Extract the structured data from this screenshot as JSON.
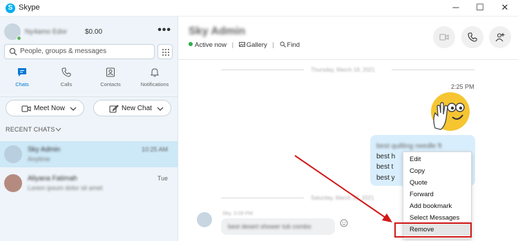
{
  "window": {
    "title": "Skype",
    "minimize": "─",
    "maximize": "☐",
    "close": "✕"
  },
  "sidebar": {
    "profile": {
      "name": "Ny4amo Edor",
      "credit": "$0.00",
      "more": "•••"
    },
    "search": {
      "placeholder": "People, groups & messages"
    },
    "tabs": [
      {
        "label": "Chats",
        "active": true,
        "icon": "chat-icon"
      },
      {
        "label": "Calls",
        "icon": "phone-icon"
      },
      {
        "label": "Contacts",
        "icon": "contacts-icon"
      },
      {
        "label": "Notifications",
        "icon": "bell-icon"
      }
    ],
    "meet_now": "Meet Now",
    "new_chat": "New Chat",
    "recent_label": "RECENT CHATS",
    "chats": [
      {
        "name": "Sky Admin",
        "preview": "Anytime",
        "time": "10:25 AM",
        "selected": true
      },
      {
        "name": "Aliyana Fatimah",
        "preview": "Lorem ipsum dolor sit amet",
        "time": "Tue"
      }
    ]
  },
  "conversation": {
    "contact_name": "Sky Admin",
    "status": "Active now",
    "gallery": "Gallery",
    "find": "Find",
    "day1": "Thursday, March 18, 2021",
    "time1": "2:25 PM",
    "bubble_lines": [
      "best quilting needle ft",
      "best h",
      "best t",
      "best y"
    ],
    "day2": "Saturday, March 20, 2021",
    "incoming_meta": "Sky, 3:28 PM",
    "incoming_text": "best desert shower tub combo"
  },
  "context_menu": {
    "items": [
      "Edit",
      "Copy",
      "Quote",
      "Forward",
      "Add bookmark",
      "Select Messages",
      "Remove"
    ],
    "highlighted": "Remove"
  },
  "colors": {
    "accent": "#0078d4",
    "selected_row": "#cde8f7",
    "outgoing_bubble": "#d9eefc",
    "annotation": "#d11818",
    "presence": "#27b24a"
  }
}
